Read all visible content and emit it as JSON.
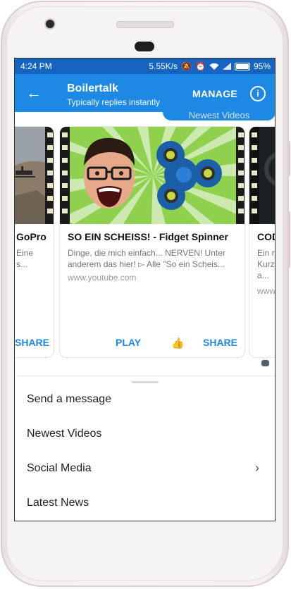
{
  "status_bar": {
    "time": "4:24 PM",
    "network_speed": "5.55K/s",
    "battery": "95%"
  },
  "header": {
    "title": "Boilertalk",
    "subtitle": "Typically replies instantly",
    "manage_label": "MANAGE",
    "info_icon_glyph": "i"
  },
  "chat": {
    "bubble_text": "Newest Videos",
    "cards": [
      {
        "title": "GoPro",
        "description": "Eine s...",
        "share_label": "SHARE"
      },
      {
        "title": "SO EIN SCHEISS! - Fidget Spinner",
        "description": "Dinge, die mich einfach... NERVEN! Unter anderem das hier! ▻ Alle \"So ein Scheis...",
        "url": "www.youtube.com",
        "play_label": "PLAY",
        "share_label": "SHARE"
      },
      {
        "title": "COD",
        "description": "Ein n Kurze a...",
        "url": "www"
      }
    ]
  },
  "menu": {
    "items": [
      {
        "label": "Send a message",
        "has_chevron": false
      },
      {
        "label": "Newest Videos",
        "has_chevron": false
      },
      {
        "label": "Social Media",
        "has_chevron": true
      },
      {
        "label": "Latest News",
        "has_chevron": false
      }
    ]
  },
  "colors": {
    "status_bar": "#1565c0",
    "app_bar": "#1e88e5",
    "link": "#1e88e5"
  },
  "icons": [
    "back-arrow-icon",
    "info-icon",
    "thumbs-up-icon",
    "chevron-right-icon",
    "signal-icon",
    "wifi-icon",
    "battery-icon",
    "alarm-icon",
    "mute-icon"
  ]
}
